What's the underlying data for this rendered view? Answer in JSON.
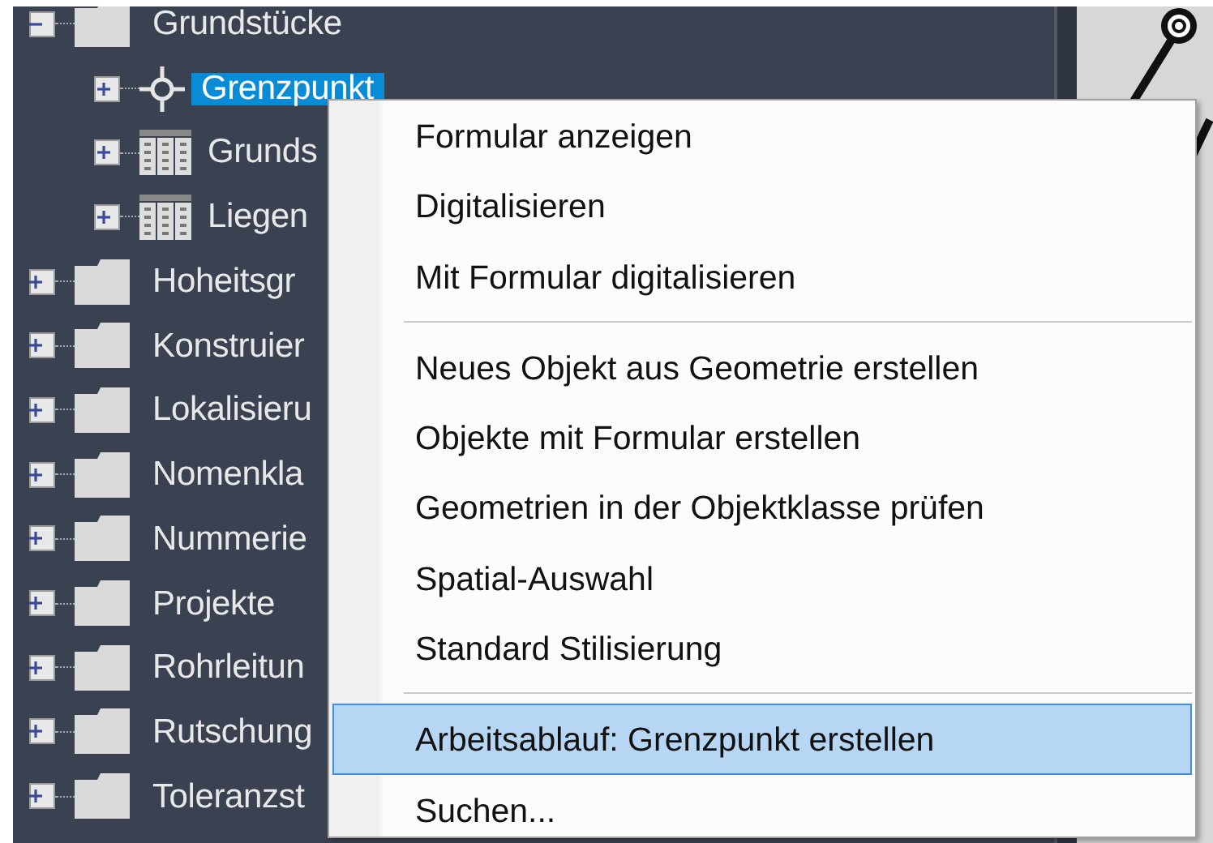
{
  "tree": {
    "items": [
      {
        "label": "Grundstücke",
        "kind": "folder",
        "expanded": true,
        "selected": false,
        "children": [
          {
            "label": "Grenzpunkt",
            "kind": "point",
            "expanded": false,
            "selected": true
          },
          {
            "label": "Grunds",
            "kind": "table",
            "expanded": false,
            "selected": false
          },
          {
            "label": "Liegen",
            "kind": "table",
            "expanded": false,
            "selected": false
          }
        ]
      },
      {
        "label": "Hoheitsgr",
        "kind": "folder",
        "expanded": false,
        "selected": false
      },
      {
        "label": "Konstruier",
        "kind": "folder",
        "expanded": false,
        "selected": false
      },
      {
        "label": "Lokalisieru",
        "kind": "folder",
        "expanded": false,
        "selected": false
      },
      {
        "label": "Nomenkla",
        "kind": "folder",
        "expanded": false,
        "selected": false
      },
      {
        "label": "Nummerie",
        "kind": "folder",
        "expanded": false,
        "selected": false
      },
      {
        "label": "Projekte",
        "kind": "folder",
        "expanded": false,
        "selected": false
      },
      {
        "label": "Rohrleitun",
        "kind": "folder",
        "expanded": false,
        "selected": false
      },
      {
        "label": "Rutschung",
        "kind": "folder",
        "expanded": false,
        "selected": false
      },
      {
        "label": "Toleranzst",
        "kind": "folder",
        "expanded": false,
        "selected": false
      }
    ]
  },
  "context_menu": {
    "groups": [
      [
        {
          "label": "Formular anzeigen",
          "selected": false
        },
        {
          "label": "Digitalisieren",
          "selected": false
        },
        {
          "label": "Mit Formular digitalisieren",
          "selected": false
        }
      ],
      [
        {
          "label": "Neues Objekt aus Geometrie erstellen",
          "selected": false
        },
        {
          "label": "Objekte mit Formular erstellen",
          "selected": false
        },
        {
          "label": "Geometrien in der Objektklasse prüfen",
          "selected": false
        },
        {
          "label": "Spatial-Auswahl",
          "selected": false
        },
        {
          "label": "Standard Stilisierung",
          "selected": false
        }
      ],
      [
        {
          "label": "Arbeitsablauf: Grenzpunkt erstellen",
          "selected": true
        },
        {
          "label": "Suchen...",
          "selected": false
        }
      ]
    ]
  }
}
